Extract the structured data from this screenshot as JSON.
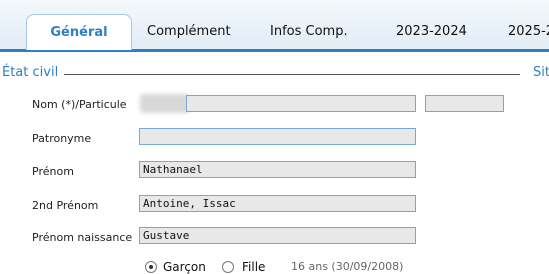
{
  "tabs": [
    {
      "label": "Général",
      "active": true
    },
    {
      "label": "Complément",
      "active": false
    },
    {
      "label": "Infos Comp.",
      "active": false
    },
    {
      "label": "2023-2024",
      "active": false
    },
    {
      "label": "2025-2",
      "active": false
    }
  ],
  "fieldset": {
    "left_legend": "État civil",
    "right_legend": "Sit"
  },
  "form": {
    "nom_label": "Nom (*)/Particule",
    "nom_value": "",
    "particule_value": "",
    "patronyme_label": "Patronyme",
    "patronyme_value": "",
    "prenom_label": "Prénom",
    "prenom_value": "Nathanael",
    "prenom2_label": "2nd Prénom",
    "prenom2_value": "Antoine, Issac",
    "prenom_naissance_label": "Prénom naissance",
    "prenom_naissance_value": "Gustave"
  },
  "gender": {
    "male_label": "Garçon",
    "female_label": "Fille",
    "selected": "male",
    "age_text": "16 ans (30/09/2008)"
  },
  "colors": {
    "accent": "#2f7fc6",
    "field_bg": "#e8e8e8",
    "field_border": "#7aa7d2"
  }
}
